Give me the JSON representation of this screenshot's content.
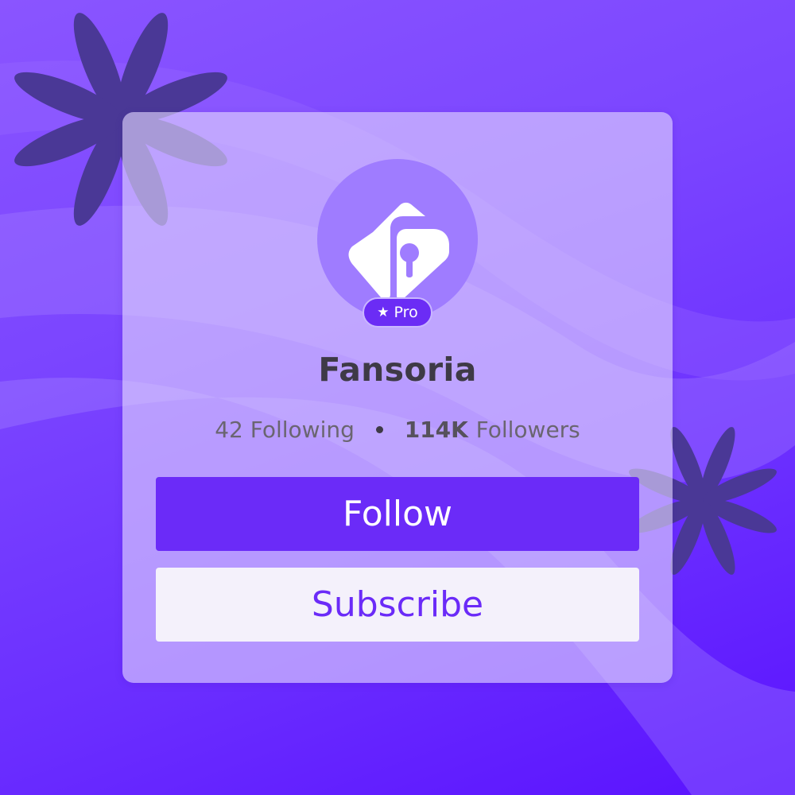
{
  "colors": {
    "background_start": "#8a55ff",
    "background_end": "#5a12ff",
    "accent": "#6b2bf8",
    "avatar_fill": "#9f7cff",
    "flower": "#4e3aa0",
    "card": "#e2d6ff"
  },
  "profile": {
    "name": "Fansoria",
    "logo_icon": "fansoria-logo-icon",
    "badge": {
      "icon": "star-icon",
      "star_glyph": "★",
      "label": "Pro"
    }
  },
  "stats": {
    "following_count": "42",
    "following_label": "Following",
    "followers_count": "114K",
    "followers_label": "Followers"
  },
  "actions": {
    "follow_label": "Follow",
    "subscribe_label": "Subscribe"
  }
}
